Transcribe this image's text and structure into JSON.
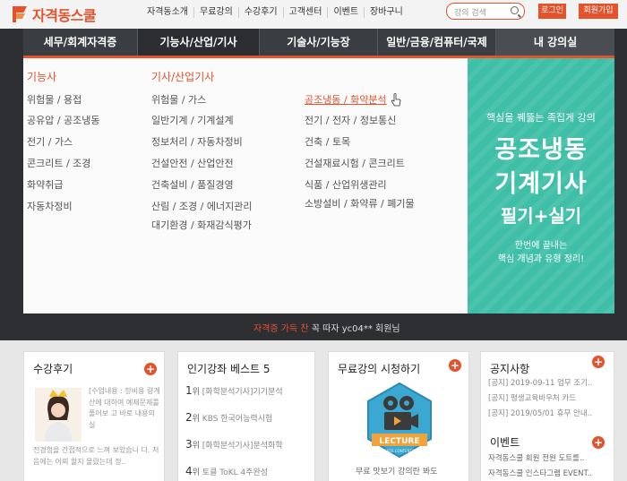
{
  "header": {
    "logo_text": "자격동스쿨",
    "nav": [
      "자격동소개",
      "무료강의",
      "수강후기",
      "고객센터",
      "이벤트",
      "장바구니"
    ],
    "search_placeholder": "강의 검색",
    "login_label": "로그인",
    "join_label": "회원가입"
  },
  "categories": [
    "세무/회계자격증",
    "기능사/산업/기사",
    "기술사/기능장",
    "일반/금융/컴퓨터/국제",
    "내 강의실"
  ],
  "menu": {
    "col1_title": "기능사",
    "col1": [
      "위험물 / 용접",
      "공유압 / 공조냉동",
      "전기 / 가스",
      "콘크리트 / 조경",
      "화약취급",
      "자동차정비"
    ],
    "col2_title": "기사/산업기사",
    "col2": [
      "위험물 / 가스",
      "일반기계 / 기계설계",
      "정보처리 / 자동차정비",
      "건설안전 / 산업안전",
      "건축설비 / 품질경영",
      "산림 / 조경 / 에너지관리",
      "대기환경 / 화재감식평가"
    ],
    "col3": [
      "공조냉동 / 화약분석",
      "전기 / 전자 / 정보통신",
      "건축 / 토목",
      "건설재료시험 / 콘크리트",
      "식품 / 산업위생관리",
      "소방설비 / 화약류 / 폐기물"
    ]
  },
  "banner": {
    "subtitle": "핵심을 꿰뚫는 족집게 강의",
    "title_line1": "공조냉동",
    "title_line2": "기계기사",
    "title_line3": "필기+실기",
    "desc_line1": "한번에 끝내는",
    "desc_line2": "핵심 개념과 유형 정리!"
  },
  "welcome": {
    "highlight": "자격증 가득 찬",
    "text": "꼭 따자 yc04** 회원님"
  },
  "reviews": {
    "title": "수강후기",
    "text": "[수업내용 : 장비용 량계산에 대하여 예제문제를 풀어보 고 바로 내용의 실",
    "text_more": "전경험을 간접적으로 느껴 보았습니 다. 처음에는 어찌 할지 몰랐는데 정.."
  },
  "best": {
    "title": "인기강좌 베스트 5",
    "suffix": "위",
    "items": [
      {
        "rank": "1",
        "text": "[화학분석기사]기기분석"
      },
      {
        "rank": "2",
        "text": "KBS 한국어능력시험"
      },
      {
        "rank": "3",
        "text": "[화학분석기사]분석화학"
      },
      {
        "rank": "4",
        "text": "토클 ToKL 4주완성"
      }
    ]
  },
  "free": {
    "title": "무료강의 시청하기",
    "badge": "LECTURE",
    "badge_sub": "FREE CONTENTS",
    "caption": "무료 맛보기 강의란 봐도"
  },
  "notices": {
    "title": "공지사항",
    "items": [
      "[공지] 2019-09-11 업무 조기..",
      "[공지] 평생교육바우처 카드",
      "[공지] 2019/05/01 휴무 안내.."
    ],
    "event_title": "이벤트",
    "events": [
      "자격동스쿨 회원 전원 도트를..",
      "자격동스쿨 인스타그램 EVENT.."
    ]
  },
  "colors": {
    "accent": "#e5532d",
    "nav_bg": "#3a3d42",
    "banner_bg": "#3fbfa7"
  }
}
